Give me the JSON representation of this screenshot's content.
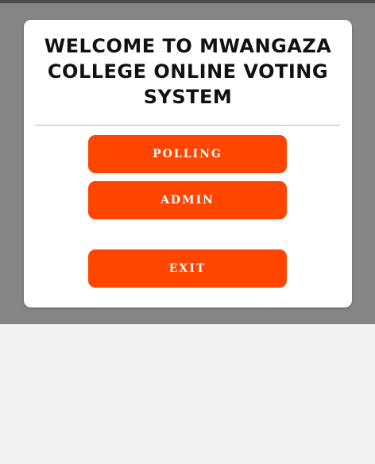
{
  "dialog": {
    "title": "WELCOME TO MWANGAZA COLLEGE ONLINE VOTING SYSTEM"
  },
  "buttons": {
    "polling": "POLLING",
    "admin": "ADMIN",
    "exit": "EXIT"
  },
  "colors": {
    "button": "#ff4500",
    "overlay": "#858585",
    "background": "#f2f2f2"
  }
}
